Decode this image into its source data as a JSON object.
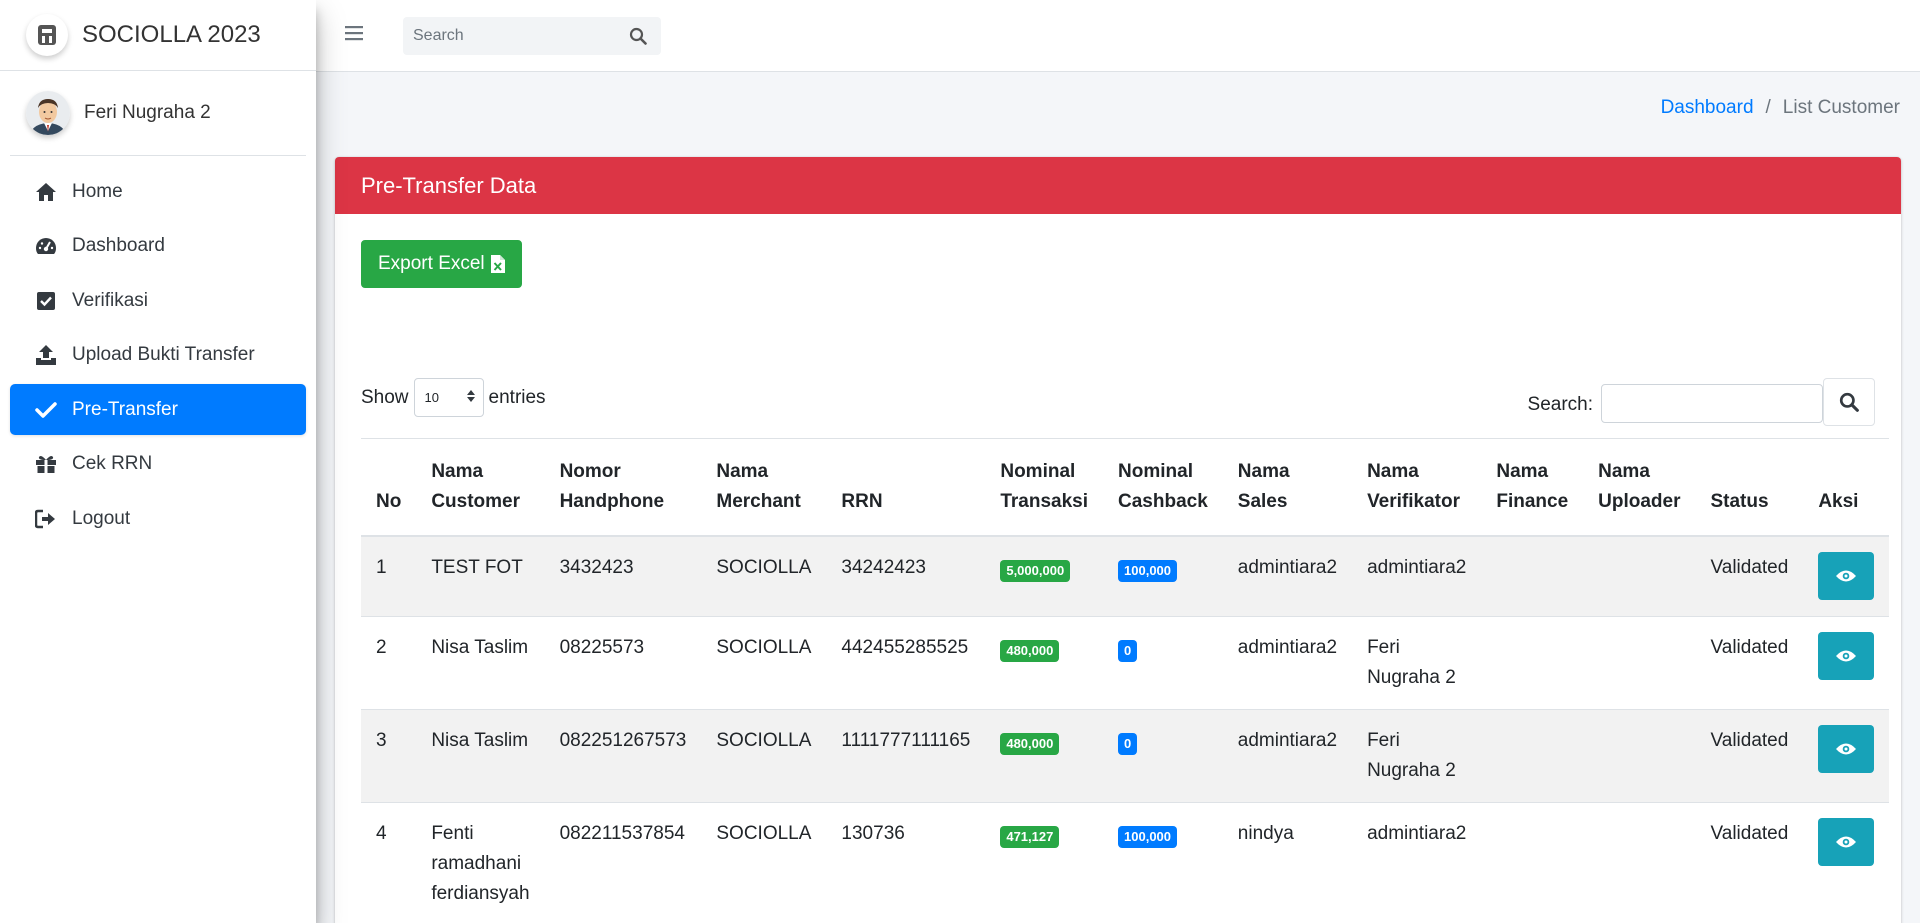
{
  "brand": {
    "title": "SOCIOLLA 2023"
  },
  "user": {
    "name": "Feri Nugraha 2"
  },
  "sidebar": {
    "items": [
      {
        "label": "Home",
        "icon": "home-icon"
      },
      {
        "label": "Dashboard",
        "icon": "tachometer-icon"
      },
      {
        "label": "Verifikasi",
        "icon": "check-square-icon"
      },
      {
        "label": "Upload Bukti Transfer",
        "icon": "upload-icon"
      },
      {
        "label": "Pre-Transfer",
        "icon": "check-icon",
        "active": true
      },
      {
        "label": "Cek RRN",
        "icon": "gift-icon"
      },
      {
        "label": "Logout",
        "icon": "sign-out-icon"
      }
    ]
  },
  "topbar": {
    "search_placeholder": "Search"
  },
  "breadcrumb": {
    "link": "Dashboard",
    "separator": "/",
    "current": "List Customer"
  },
  "card": {
    "title": "Pre-Transfer Data",
    "export_label": "Export Excel"
  },
  "datatable": {
    "show_label": "Show",
    "length_value": "10",
    "entries_label": "entries",
    "search_label": "Search:",
    "columns": [
      "No",
      "Nama Customer",
      "Nomor Handphone",
      "Nama Merchant",
      "RRN",
      "Nominal Transaksi",
      "Nominal Cashback",
      "Nama Sales",
      "Nama Verifikator",
      "Nama Finance",
      "Nama Uploader",
      "Status",
      "Aksi"
    ],
    "rows": [
      {
        "no": "1",
        "customer": "TEST FOT",
        "phone": "3432423",
        "merchant": "SOCIOLLA",
        "rrn": "34242423",
        "transaksi": "5,000,000",
        "cashback": "100,000",
        "sales": "admintiara2",
        "verifikator": "admintiara2",
        "finance": "",
        "uploader": "",
        "status": "Validated"
      },
      {
        "no": "2",
        "customer": "Nisa Taslim",
        "phone": "08225573",
        "merchant": "SOCIOLLA",
        "rrn": "442455285525",
        "transaksi": "480,000",
        "cashback": "0",
        "sales": "admintiara2",
        "verifikator": "Feri Nugraha 2",
        "finance": "",
        "uploader": "",
        "status": "Validated"
      },
      {
        "no": "3",
        "customer": "Nisa Taslim",
        "phone": "082251267573",
        "merchant": "SOCIOLLA",
        "rrn": "1111777111165",
        "transaksi": "480,000",
        "cashback": "0",
        "sales": "admintiara2",
        "verifikator": "Feri Nugraha 2",
        "finance": "",
        "uploader": "",
        "status": "Validated"
      },
      {
        "no": "4",
        "customer": "Fenti ramadhani ferdiansyah",
        "phone": "082211537854",
        "merchant": "SOCIOLLA",
        "rrn": "130736",
        "transaksi": "471,127",
        "cashback": "100,000",
        "sales": "nindya",
        "verifikator": "admintiara2",
        "finance": "",
        "uploader": "",
        "status": "Validated"
      }
    ]
  },
  "colors": {
    "header": "#dc3545",
    "active_nav": "#007bff",
    "success": "#28a745",
    "primary": "#007bff",
    "info": "#17a2b8"
  }
}
